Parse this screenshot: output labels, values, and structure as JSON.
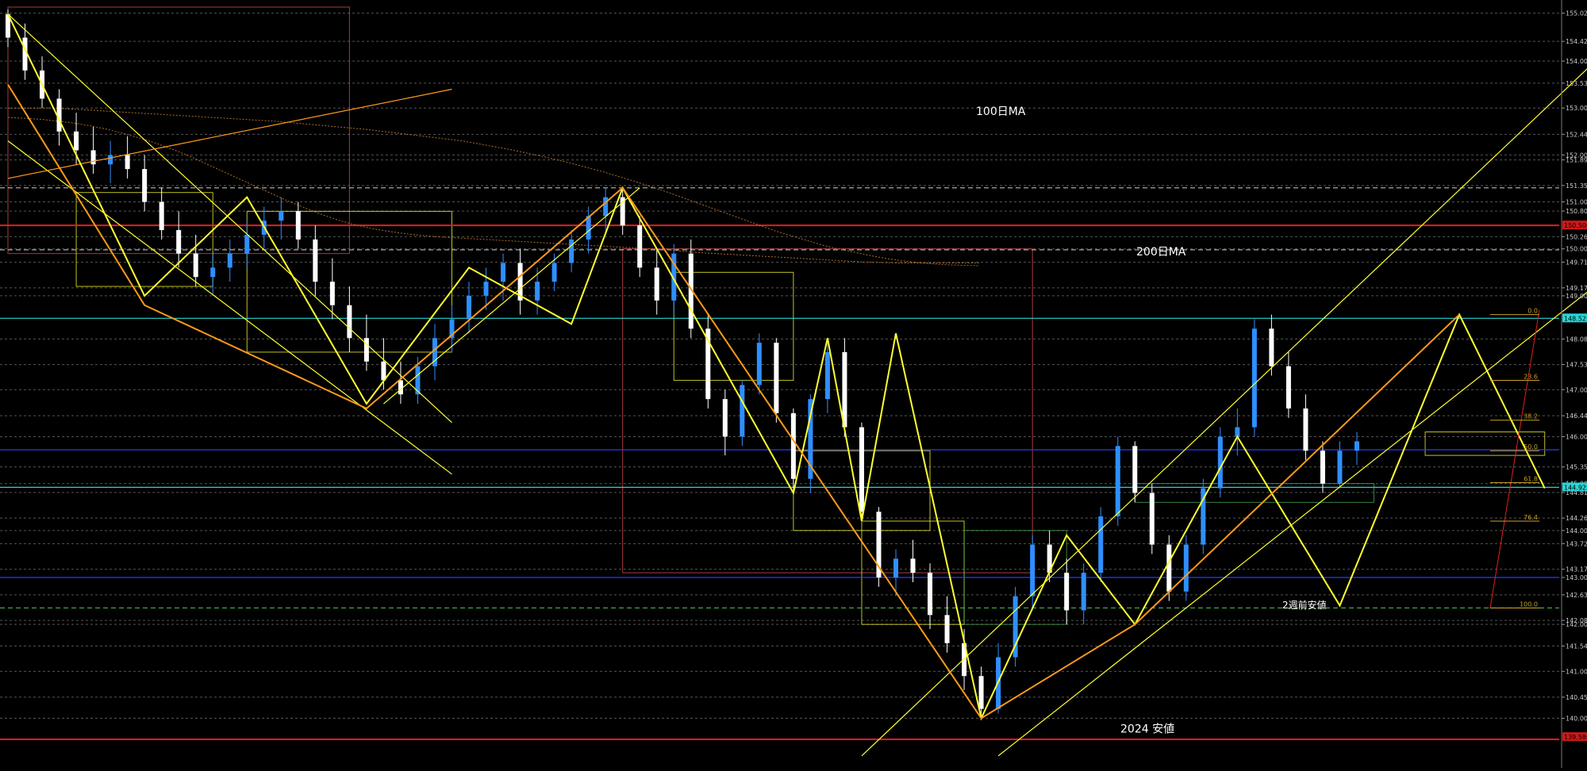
{
  "chart_data": {
    "type": "candlestick",
    "symbol": "USD/JPY",
    "ylim": [
      139.35,
      155.2
    ],
    "y_axis_labels": [
      "155.020",
      "154.420",
      "154.000",
      "153.530",
      "153.000",
      "152.440",
      "152.000",
      "151.895",
      "151.350",
      "151.000",
      "150.805",
      "150.260",
      "150.000",
      "149.715",
      "149.170",
      "149.000",
      "148.080",
      "147.535",
      "147.000",
      "146.445",
      "146.000",
      "145.355",
      "145.000",
      "144.810",
      "144.265",
      "144.000",
      "143.720",
      "143.175",
      "143.000",
      "142.630",
      "142.085",
      "142.000",
      "141.540",
      "141.000",
      "140.450",
      "140.000"
    ],
    "y_axis_values": [
      155.02,
      154.42,
      154.0,
      153.53,
      153.0,
      152.44,
      152.0,
      151.895,
      151.35,
      151.0,
      150.805,
      150.26,
      150.0,
      149.715,
      149.17,
      149.0,
      148.08,
      147.535,
      147.0,
      146.445,
      146.0,
      145.355,
      145.0,
      144.81,
      144.265,
      144.0,
      143.72,
      143.175,
      143.0,
      142.63,
      142.085,
      142.0,
      141.54,
      141.0,
      140.45,
      140.0
    ],
    "highlighted_price_labels": [
      {
        "value": 150.5,
        "text": "150.500",
        "color": "#d01818"
      },
      {
        "value": 148.52,
        "text": "148.525",
        "color": "#2ad4d4"
      },
      {
        "value": 144.92,
        "text": "144.925",
        "color": "#2ad4d4"
      },
      {
        "value": 139.6,
        "text": "139.580",
        "color": "#d01818"
      }
    ],
    "horizontal_levels": [
      {
        "value": 150.5,
        "color": "#e02020",
        "style": "solid"
      },
      {
        "value": 148.52,
        "color": "#2ad4d4",
        "style": "solid"
      },
      {
        "value": 144.92,
        "color": "#2ad4d4",
        "style": "solid"
      },
      {
        "value": 145.72,
        "color": "#2a3cff",
        "style": "solid"
      },
      {
        "value": 143.0,
        "color": "#2a3cff",
        "style": "solid"
      },
      {
        "value": 139.55,
        "color": "#e02020",
        "style": "solid"
      },
      {
        "value": 151.3,
        "color": "#bbbbbb",
        "style": "dashed"
      },
      {
        "value": 149.98,
        "color": "#bbbbbb",
        "style": "dashed"
      },
      {
        "value": 142.35,
        "color": "#4caf50",
        "style": "dashed"
      }
    ],
    "annotations": [
      "100日MA",
      "200日MA",
      "2週前安値",
      "2024 安値"
    ],
    "fibonacci_labels": [
      "0.0",
      "23.6",
      "38.2",
      "50.0",
      "61.8",
      "76.4",
      "100.0"
    ],
    "fibonacci_levels": [
      148.6,
      147.2,
      146.35,
      145.7,
      145.02,
      144.2,
      142.35
    ],
    "ohlc": [
      [
        155.0,
        155.1,
        154.3,
        154.5
      ],
      [
        154.5,
        154.8,
        153.6,
        153.8
      ],
      [
        153.8,
        154.1,
        153.0,
        153.2
      ],
      [
        153.2,
        153.4,
        152.2,
        152.5
      ],
      [
        152.5,
        152.9,
        151.8,
        152.1
      ],
      [
        152.1,
        152.6,
        151.6,
        151.8
      ],
      [
        151.8,
        152.3,
        151.4,
        152.0
      ],
      [
        152.0,
        152.4,
        151.5,
        151.7
      ],
      [
        151.7,
        152.0,
        150.8,
        151.0
      ],
      [
        151.0,
        151.3,
        150.2,
        150.4
      ],
      [
        150.4,
        150.8,
        149.6,
        149.9
      ],
      [
        149.9,
        150.3,
        149.2,
        149.4
      ],
      [
        149.4,
        149.9,
        149.0,
        149.6
      ],
      [
        149.6,
        150.2,
        149.3,
        149.9
      ],
      [
        149.9,
        150.6,
        149.6,
        150.3
      ],
      [
        150.3,
        150.9,
        150.0,
        150.6
      ],
      [
        150.6,
        151.1,
        150.2,
        150.8
      ],
      [
        150.8,
        151.0,
        150.0,
        150.2
      ],
      [
        150.2,
        150.5,
        149.0,
        149.3
      ],
      [
        149.3,
        149.8,
        148.5,
        148.8
      ],
      [
        148.8,
        149.2,
        147.8,
        148.1
      ],
      [
        148.1,
        148.6,
        147.4,
        147.6
      ],
      [
        147.6,
        148.1,
        147.0,
        147.2
      ],
      [
        147.2,
        147.6,
        146.7,
        146.9
      ],
      [
        146.9,
        147.7,
        146.7,
        147.5
      ],
      [
        147.5,
        148.4,
        147.2,
        148.1
      ],
      [
        148.1,
        148.8,
        147.8,
        148.5
      ],
      [
        148.5,
        149.3,
        148.2,
        149.0
      ],
      [
        149.0,
        149.6,
        148.7,
        149.3
      ],
      [
        149.3,
        149.9,
        148.9,
        149.7
      ],
      [
        149.7,
        150.0,
        148.6,
        148.9
      ],
      [
        148.9,
        149.6,
        148.6,
        149.3
      ],
      [
        149.3,
        149.9,
        149.1,
        149.7
      ],
      [
        149.7,
        150.4,
        149.5,
        150.2
      ],
      [
        150.2,
        150.9,
        149.9,
        150.7
      ],
      [
        150.7,
        151.3,
        150.4,
        151.1
      ],
      [
        151.1,
        151.3,
        150.3,
        150.5
      ],
      [
        150.5,
        150.7,
        149.4,
        149.6
      ],
      [
        149.6,
        150.0,
        148.6,
        148.9
      ],
      [
        148.9,
        150.1,
        148.6,
        149.9
      ],
      [
        149.9,
        150.2,
        148.1,
        148.3
      ],
      [
        148.3,
        148.6,
        146.6,
        146.8
      ],
      [
        146.8,
        147.0,
        145.6,
        146.0
      ],
      [
        146.0,
        147.2,
        145.8,
        147.1
      ],
      [
        147.1,
        148.2,
        146.9,
        148.0
      ],
      [
        148.0,
        148.1,
        146.3,
        146.5
      ],
      [
        146.5,
        146.6,
        144.9,
        145.1
      ],
      [
        145.1,
        146.9,
        144.8,
        146.8
      ],
      [
        146.8,
        148.0,
        146.5,
        147.8
      ],
      [
        147.8,
        148.1,
        146.0,
        146.2
      ],
      [
        146.2,
        146.3,
        144.2,
        144.4
      ],
      [
        144.4,
        144.5,
        142.8,
        143.0
      ],
      [
        143.0,
        143.6,
        142.6,
        143.4
      ],
      [
        143.4,
        143.8,
        142.9,
        143.1
      ],
      [
        143.1,
        143.3,
        141.9,
        142.2
      ],
      [
        142.2,
        142.6,
        141.4,
        141.6
      ],
      [
        141.6,
        141.9,
        140.6,
        140.9
      ],
      [
        140.9,
        141.1,
        140.0,
        140.2
      ],
      [
        140.2,
        141.6,
        140.1,
        141.3
      ],
      [
        141.3,
        142.8,
        141.1,
        142.6
      ],
      [
        142.6,
        143.9,
        142.3,
        143.7
      ],
      [
        143.7,
        144.0,
        142.9,
        143.1
      ],
      [
        143.1,
        143.4,
        142.0,
        142.3
      ],
      [
        142.3,
        143.3,
        142.0,
        143.1
      ],
      [
        143.1,
        144.5,
        142.9,
        144.3
      ],
      [
        144.3,
        146.0,
        144.1,
        145.8
      ],
      [
        145.8,
        145.9,
        144.6,
        144.8
      ],
      [
        144.8,
        145.0,
        143.5,
        143.7
      ],
      [
        143.7,
        143.9,
        142.5,
        142.7
      ],
      [
        142.7,
        143.9,
        142.5,
        143.7
      ],
      [
        143.7,
        145.1,
        143.5,
        144.9
      ],
      [
        144.9,
        146.2,
        144.7,
        146.0
      ],
      [
        146.0,
        146.6,
        145.6,
        146.2
      ],
      [
        146.2,
        148.5,
        146.0,
        148.3
      ],
      [
        148.3,
        148.6,
        147.3,
        147.5
      ],
      [
        147.5,
        147.8,
        146.4,
        146.6
      ],
      [
        146.6,
        146.9,
        145.5,
        145.7
      ],
      [
        145.7,
        145.9,
        144.8,
        145.0
      ],
      [
        145.0,
        145.9,
        144.9,
        145.7
      ],
      [
        145.7,
        146.1,
        145.4,
        145.9
      ]
    ],
    "moving_averages": [
      {
        "name": "100日MA",
        "color": "#c07a2a",
        "values": [
          153.0,
          153.0,
          153.0,
          153.0,
          152.98,
          152.96,
          152.94,
          152.92,
          152.9,
          152.88,
          152.86,
          152.84,
          152.82,
          152.8,
          152.78,
          152.76,
          152.74,
          152.72,
          152.69,
          152.66,
          152.63,
          152.6,
          152.57,
          152.54,
          152.5,
          152.46,
          152.42,
          152.38,
          152.34,
          152.3,
          152.24,
          152.18,
          152.12,
          152.05,
          151.98,
          151.9,
          151.82,
          151.73,
          151.64,
          151.54,
          151.44,
          151.33,
          151.22,
          151.1,
          150.98,
          150.86,
          150.74,
          150.62,
          150.5,
          150.38,
          150.28,
          150.18,
          150.08,
          150.0,
          149.93,
          149.86,
          149.8,
          149.75,
          149.71,
          149.68,
          149.66,
          149.65,
          149.64
        ]
      },
      {
        "name": "200日MA",
        "color": "#c07a2a",
        "values": [
          152.8,
          152.78,
          152.76,
          152.72,
          152.68,
          152.62,
          152.55,
          152.46,
          152.36,
          152.25,
          152.12,
          151.98,
          151.82,
          151.66,
          151.5,
          151.34,
          151.18,
          151.02,
          150.88,
          150.74,
          150.62,
          150.52,
          150.44,
          150.38,
          150.33,
          150.29,
          150.26,
          150.24,
          150.22,
          150.2,
          150.18,
          150.16,
          150.14,
          150.12,
          150.1,
          150.08,
          150.06,
          150.04,
          150.02,
          150.0,
          149.98,
          149.95,
          149.92,
          149.9,
          149.88,
          149.86,
          149.84,
          149.82,
          149.8,
          149.78,
          149.76,
          149.74,
          149.72,
          149.71,
          149.7,
          149.7,
          149.7,
          149.7,
          149.7,
          149.7
        ]
      }
    ],
    "zigzag": [
      {
        "color": "#ffff30",
        "points": [
          [
            0,
            155.0
          ],
          [
            8,
            149.0
          ],
          [
            14,
            151.1
          ],
          [
            21,
            146.7
          ],
          [
            27,
            149.6
          ],
          [
            33,
            148.4
          ],
          [
            36,
            151.3
          ],
          [
            46,
            144.8
          ],
          [
            48,
            148.1
          ],
          [
            50,
            144.2
          ],
          [
            52,
            148.2
          ],
          [
            57,
            140.0
          ],
          [
            62,
            143.9
          ],
          [
            66,
            142.0
          ],
          [
            72,
            146.0
          ],
          [
            78,
            142.4
          ],
          [
            85,
            148.6
          ],
          [
            90,
            144.9
          ]
        ]
      },
      {
        "color": "#ff9a1a",
        "points": [
          [
            0,
            153.5
          ],
          [
            8,
            148.8
          ],
          [
            21,
            146.6
          ],
          [
            36,
            151.3
          ],
          [
            57,
            140.0
          ],
          [
            66,
            142.0
          ],
          [
            85,
            148.6
          ]
        ]
      }
    ]
  },
  "watermark_pixels": {}
}
